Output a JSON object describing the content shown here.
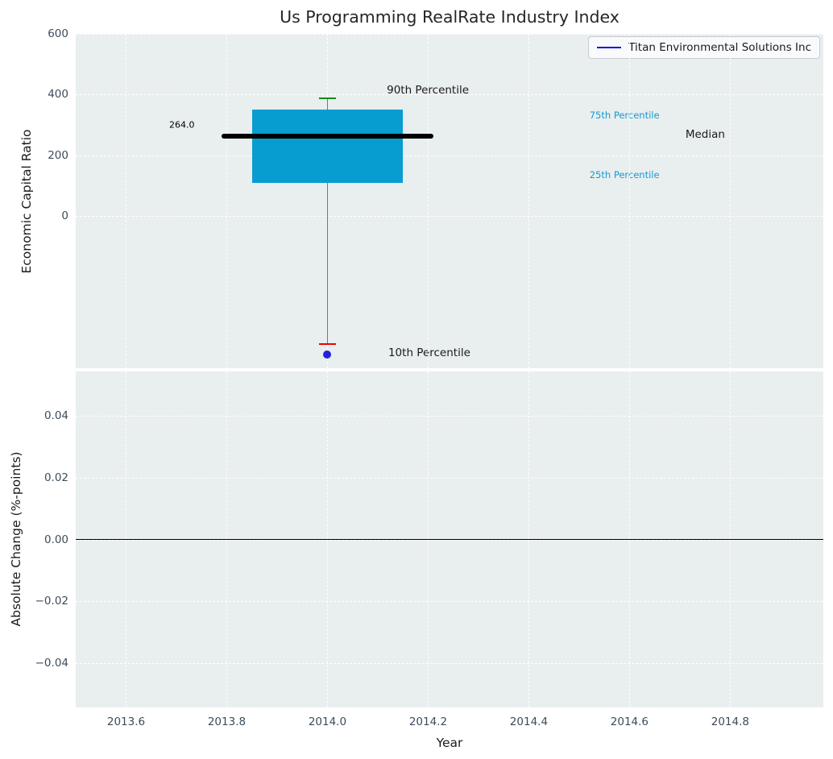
{
  "chart_data": [
    {
      "type": "boxplot",
      "title": "Us Programming RealRate Industry Index",
      "ylabel": "Economic Capital Ratio",
      "xlim": [
        2013.5,
        2014.985
      ],
      "ylim": [
        -500,
        600
      ],
      "xticks": [
        2013.6,
        2013.8,
        2014.0,
        2014.2,
        2014.4,
        2014.6,
        2014.8
      ],
      "xtick_labels": [
        "2013.6",
        "2013.8",
        "2014.0",
        "2014.2",
        "2014.4",
        "2014.6",
        "2014.8"
      ],
      "yticks": [
        600,
        400,
        200,
        0
      ],
      "ytick_labels": [
        "600",
        "400",
        "200",
        "0"
      ],
      "grid": true,
      "background_color": "#e9eeef",
      "legend": {
        "label": "Titan Environmental Solutions Inc",
        "line_color": "#0a0af0",
        "position": "upper right"
      },
      "box": {
        "x": 2014.0,
        "box_halfwidth": 0.15,
        "median": 264.0,
        "median_line_halfwidth": 0.21,
        "q25": 110,
        "q75": 352,
        "p10": -420,
        "p90": 388,
        "cap_halfwidth": 0.0175,
        "box_color": "#089dd1",
        "median_color": "#000000",
        "p90_cap_color": "#0a8f0a",
        "p10_cap_color": "#ee0000",
        "whisker_color": "#777777"
      },
      "company_point": {
        "x": 2014.0,
        "y": -455,
        "color": "#2222dd"
      },
      "annotations": {
        "value_label": "264.0",
        "p90_label": "90th Percentile",
        "p10_label": "10th Percentile",
        "p75_label": "75th Percentile",
        "p25_label": "25th Percentile",
        "median_label": "Median"
      }
    },
    {
      "type": "line",
      "ylabel": "Absolute Change (%-points)",
      "xlabel": "Year",
      "xlim": [
        2013.5,
        2014.985
      ],
      "ylim": [
        -0.0545,
        0.0545
      ],
      "xticks": [
        2013.6,
        2013.8,
        2014.0,
        2014.2,
        2014.4,
        2014.6,
        2014.8
      ],
      "xtick_labels": [
        "2013.6",
        "2013.8",
        "2014.0",
        "2014.2",
        "2014.4",
        "2014.6",
        "2014.8"
      ],
      "yticks": [
        0.04,
        0.02,
        0.0,
        -0.02,
        -0.04
      ],
      "ytick_labels": [
        "0.04",
        "0.02",
        "0.00",
        "−0.02",
        "−0.04"
      ],
      "grid": true,
      "background_color": "#e9eeef",
      "zero_line": 0.0,
      "zero_line_color": "#000000",
      "series": []
    }
  ]
}
